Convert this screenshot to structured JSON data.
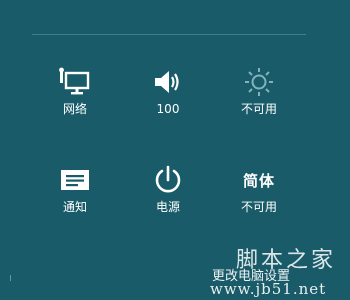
{
  "settings_panel": {
    "tiles": [
      {
        "label": "网络",
        "icon": "network-monitor-icon"
      },
      {
        "label": "100",
        "icon": "volume-icon"
      },
      {
        "label": "不可用",
        "icon": "brightness-icon"
      },
      {
        "label": "通知",
        "icon": "notifications-icon"
      },
      {
        "label": "电源",
        "icon": "power-icon"
      },
      {
        "label": "不可用",
        "icon": "keyboard-language-icon",
        "text_glyph": "简体"
      }
    ],
    "change_pc_settings": "更改电脑设置"
  },
  "watermark": {
    "site_name": "脚本之家",
    "site_url": "www.jb51.net"
  },
  "colors": {
    "background": "#195b69",
    "foreground": "#ffffff"
  }
}
